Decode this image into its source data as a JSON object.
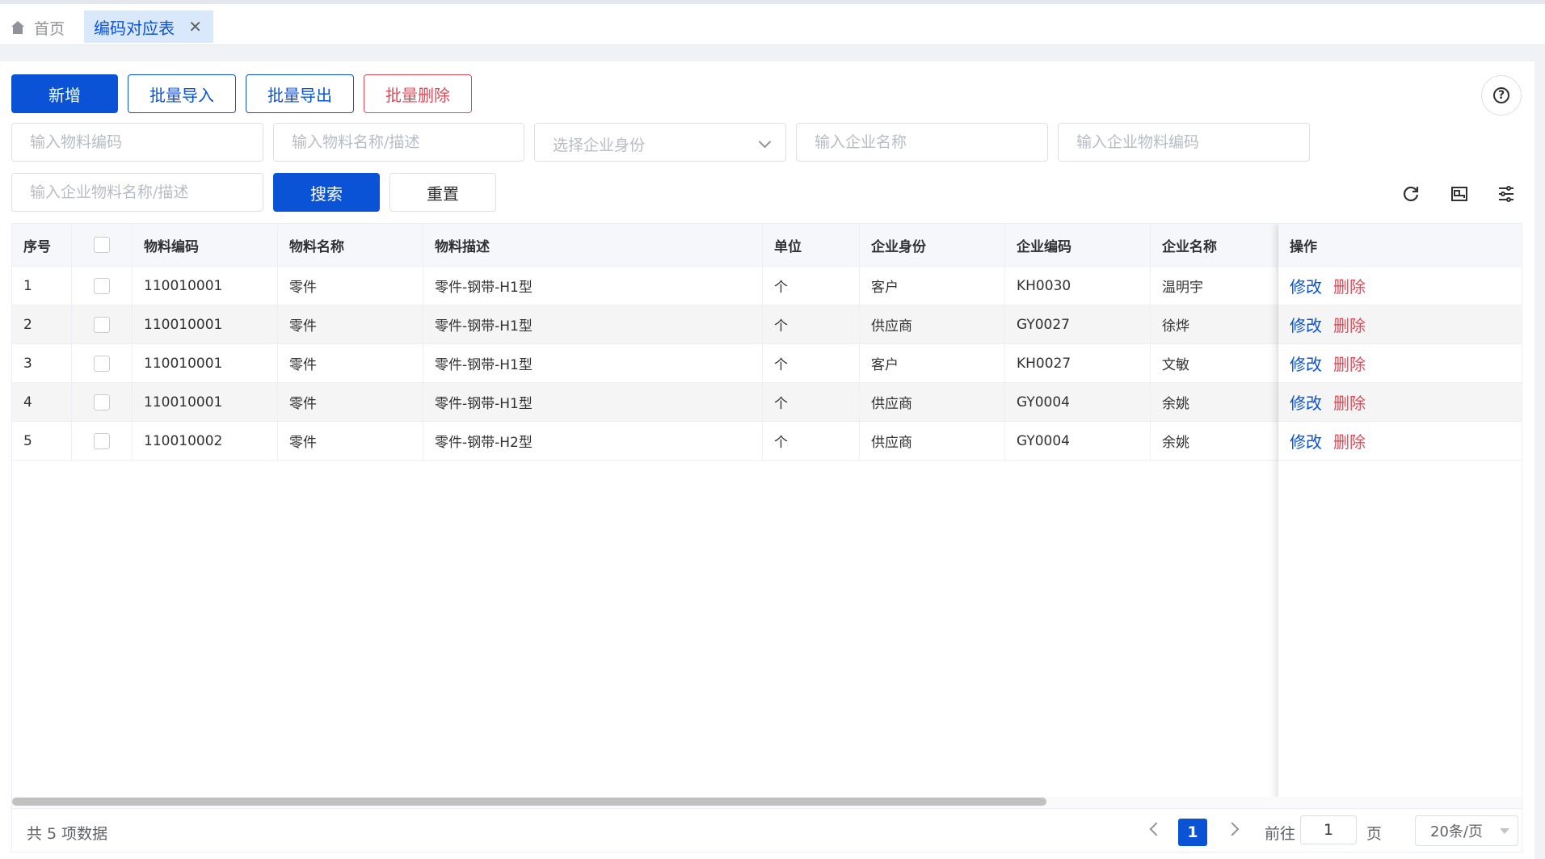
{
  "tabs": {
    "home_label": "首页",
    "active_label": "编码对应表",
    "close_symbol": "✕"
  },
  "toolbar": {
    "add_label": "新增",
    "import_label": "批量导入",
    "export_label": "批量导出",
    "delete_label": "批量删除",
    "help_symbol": "?"
  },
  "filters": {
    "material_code_placeholder": "输入物料编码",
    "material_name_placeholder": "输入物料名称/描述",
    "identity_placeholder": "选择企业身份",
    "enterprise_name_placeholder": "输入企业名称",
    "enterprise_material_code_placeholder": "输入企业物料编码",
    "enterprise_material_name_placeholder": "输入企业物料名称/描述",
    "search_label": "搜索",
    "reset_label": "重置"
  },
  "table": {
    "headers": {
      "index": "序号",
      "code": "物料编码",
      "name": "物料名称",
      "desc": "物料描述",
      "unit": "单位",
      "identity": "企业身份",
      "ent_code": "企业编码",
      "ent_name": "企业名称",
      "ops": "操作"
    },
    "edit_label": "修改",
    "delete_label": "删除",
    "rows": [
      {
        "index": "1",
        "code": "110010001",
        "name": "零件",
        "desc": "零件-钢带-H1型",
        "unit": "个",
        "identity": "客户",
        "ent_code": "KH0030",
        "ent_name": "温明宇"
      },
      {
        "index": "2",
        "code": "110010001",
        "name": "零件",
        "desc": "零件-钢带-H1型",
        "unit": "个",
        "identity": "供应商",
        "ent_code": "GY0027",
        "ent_name": "徐烨"
      },
      {
        "index": "3",
        "code": "110010001",
        "name": "零件",
        "desc": "零件-钢带-H1型",
        "unit": "个",
        "identity": "客户",
        "ent_code": "KH0027",
        "ent_name": "文敏"
      },
      {
        "index": "4",
        "code": "110010001",
        "name": "零件",
        "desc": "零件-钢带-H1型",
        "unit": "个",
        "identity": "供应商",
        "ent_code": "GY0004",
        "ent_name": "余姚"
      },
      {
        "index": "5",
        "code": "110010002",
        "name": "零件",
        "desc": "零件-钢带-H2型",
        "unit": "个",
        "identity": "供应商",
        "ent_code": "GY0004",
        "ent_name": "余姚"
      }
    ]
  },
  "pagination": {
    "total_text": "共 5 项数据",
    "current_page": "1",
    "goto_prefix": "前往",
    "goto_value": "1",
    "goto_suffix": "页",
    "page_size": "20条/页"
  },
  "colors": {
    "primary": "#0b53d6",
    "danger": "#e04a57",
    "tab_active_bg": "#d9e8fb"
  }
}
